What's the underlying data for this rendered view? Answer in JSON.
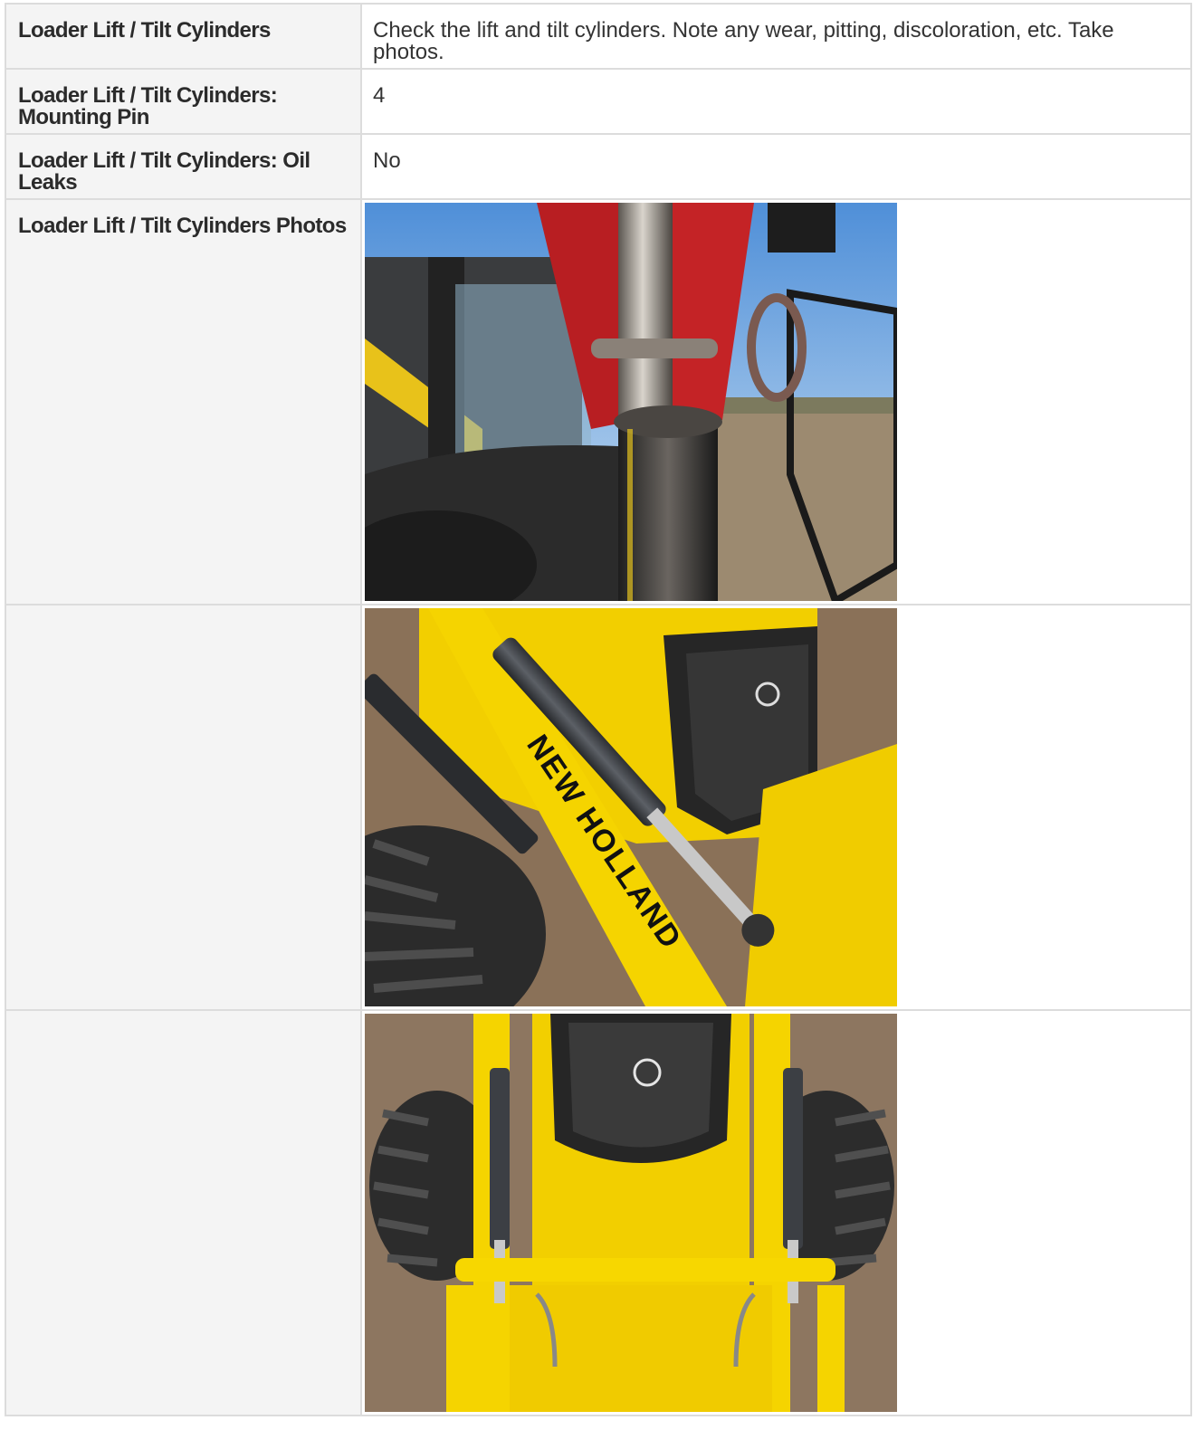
{
  "rows": [
    {
      "label": "Loader Lift / Tilt Cylinders",
      "value": "Check the lift and tilt cylinders. Note any wear, pitting, discoloration, etc. Take photos."
    },
    {
      "label": "Loader Lift / Tilt Cylinders: Mounting Pin",
      "value": "4"
    },
    {
      "label": "Loader Lift / Tilt Cylinders: Oil Leaks",
      "value": "No"
    }
  ],
  "photos": {
    "label": "Loader Lift / Tilt Cylinders Photos",
    "items": [
      {
        "logo_text": ""
      },
      {
        "logo_text": "NEW HOLLAND"
      },
      {
        "logo_text": ""
      }
    ]
  },
  "colors": {
    "label_bg": "#f4f4f4",
    "border": "#dcdcdc",
    "machine_yellow": "#f2cf00",
    "cylinder_red": "#c42326",
    "steel_gray": "#4a4d52",
    "ground_brown": "#8a7158",
    "sky_blue": "#6aa8e0"
  }
}
